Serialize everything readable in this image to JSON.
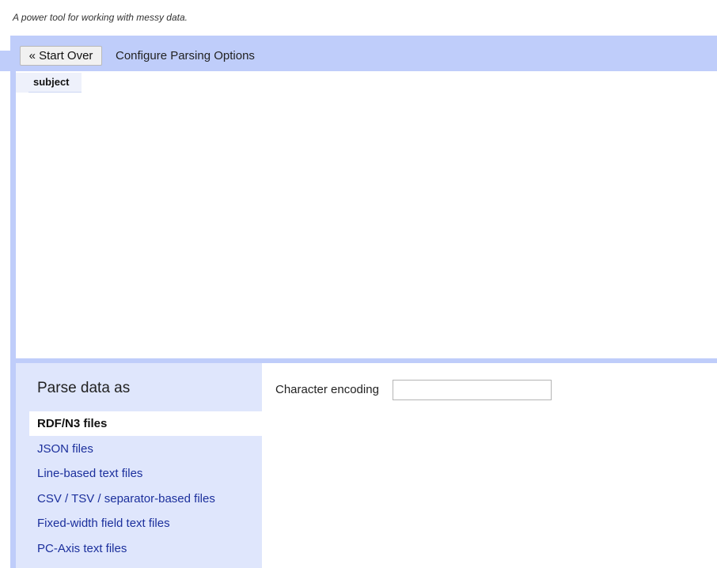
{
  "tagline": "A power tool for working with messy data.",
  "header": {
    "start_over_label": "« Start Over",
    "title": "Configure Parsing Options"
  },
  "preview": {
    "columns": [
      "subject"
    ]
  },
  "parse_panel": {
    "title": "Parse data as",
    "formats": [
      {
        "label": "RDF/N3 files",
        "selected": true
      },
      {
        "label": "JSON files",
        "selected": false
      },
      {
        "label": "Line-based text files",
        "selected": false
      },
      {
        "label": "CSV / TSV / separator-based files",
        "selected": false
      },
      {
        "label": "Fixed-width field text files",
        "selected": false
      },
      {
        "label": "PC-Axis text files",
        "selected": false
      }
    ]
  },
  "options": {
    "encoding_label": "Character encoding",
    "encoding_value": ""
  },
  "colors": {
    "accent_bar": "#bfcdfa",
    "panel_bg": "#dfe6fc",
    "link": "#1b2f9c"
  }
}
